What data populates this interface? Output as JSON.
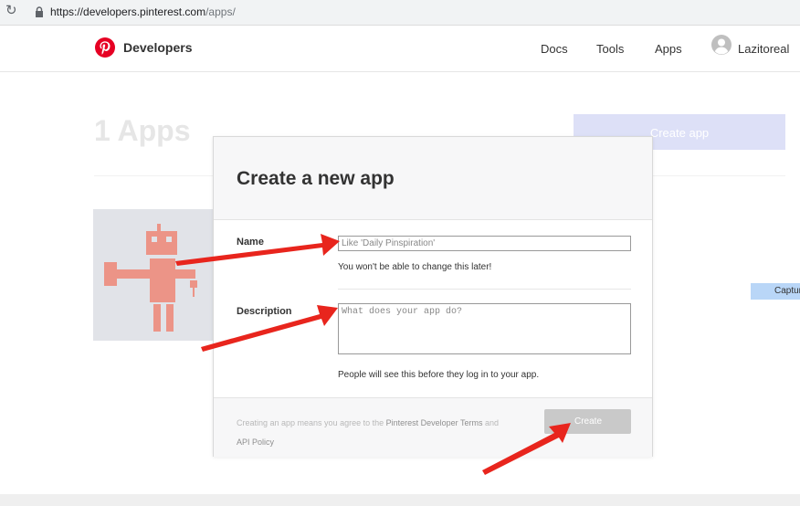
{
  "browser": {
    "url_host": "https://developers.pinterest.com",
    "url_path": "/apps/"
  },
  "header": {
    "brand": "Developers",
    "nav": [
      "Docs",
      "Tools",
      "Apps"
    ],
    "user": "Lazitoreal"
  },
  "page": {
    "title": "1 Apps",
    "create_app_label": "Create app",
    "capture_label": "Captur"
  },
  "modal": {
    "title": "Create a new app",
    "name_label": "Name",
    "name_placeholder": "Like 'Daily Pinspiration'",
    "name_hint": "You won't be able to change this later!",
    "description_label": "Description",
    "description_placeholder": "What does your app do?",
    "description_hint": "People will see this before they log in to your app.",
    "terms_prefix": "Creating an app means you agree to the ",
    "terms_link1": "Pinterest Developer Terms",
    "terms_mid": " and",
    "terms_link2": "API Policy",
    "create_label": "Create"
  },
  "colors": {
    "brand_red": "#e60023",
    "arrow_red": "#e8251d",
    "create_app_bg": "#dde0f7"
  },
  "icons": [
    "reload-icon",
    "lock-icon",
    "pinterest-logo-icon",
    "avatar-icon",
    "robot-illustration"
  ]
}
